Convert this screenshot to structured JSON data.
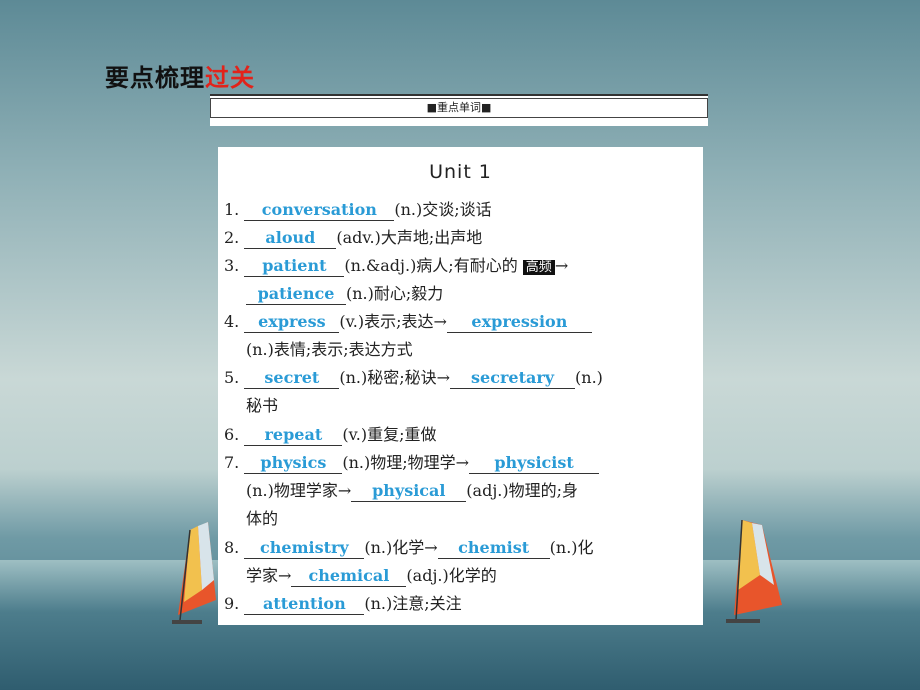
{
  "title": {
    "main": "要点梳理",
    "accent": "过关"
  },
  "banner": "■重点单词■",
  "unit": "Unit 1",
  "items": [
    {
      "num": "1.",
      "ans": "conversation",
      "after": "(n.)交谈;谈话"
    },
    {
      "num": "2.",
      "ans": "aloud",
      "after": "(adv.)大声地;出声地"
    },
    {
      "num": "3.",
      "ans": "patient",
      "after": "(n.&adj.)病人;有耐心的 ",
      "tag": "高频",
      "arrow": "→"
    },
    {
      "ans": "patience",
      "after": "(n.)耐心;毅力"
    },
    {
      "num": "4.",
      "ans": "express",
      "after": "(v.)表示;表达→",
      "ans2": "expression"
    },
    {
      "text": "(n.)表情;表示;表达方式"
    },
    {
      "num": "5.",
      "ans": "secret",
      "after": "(n.)秘密;秘诀→",
      "ans2": "secretary",
      "after2": "(n.)"
    },
    {
      "text": "秘书"
    },
    {
      "num": "6.",
      "ans": "repeat",
      "after": "(v.)重复;重做"
    },
    {
      "num": "7.",
      "ans": "physics",
      "after": "(n.)物理;物理学→",
      "ans2": "physicist"
    },
    {
      "pre": "(n.)物理学家→",
      "ans": "physical",
      "after": "(adj.)物理的;身"
    },
    {
      "text": "体的"
    },
    {
      "num": "8.",
      "ans": "chemistry",
      "after": "(n.)化学→",
      "ans2": "chemist",
      "after2": "(n.)化"
    },
    {
      "pre": "学家→",
      "ans": "chemical",
      "after": "(adj.)化学的"
    },
    {
      "num": "9.",
      "ans": "attention",
      "after": "(n.)注意;关注"
    }
  ]
}
